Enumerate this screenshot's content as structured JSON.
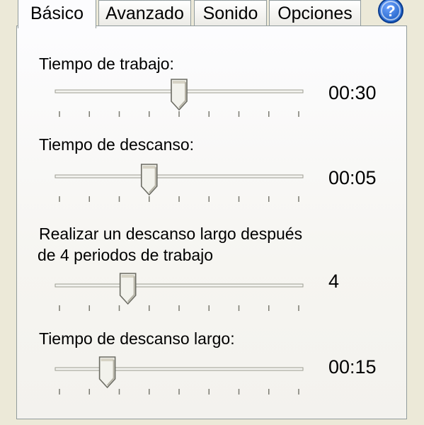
{
  "tabs": [
    {
      "label": "Básico",
      "active": true
    },
    {
      "label": "Avanzado",
      "active": false
    },
    {
      "label": "Sonido",
      "active": false
    },
    {
      "label": "Opciones",
      "active": false
    }
  ],
  "help": {
    "icon": "help-icon",
    "glyph": "?"
  },
  "settings": [
    {
      "label": "Tiempo de trabajo:",
      "value": "00:30",
      "level": 0.5
    },
    {
      "label": "Tiempo de descanso:",
      "value": "00:05",
      "level": 0.375
    },
    {
      "label_line1": "Realizar un descanso largo después",
      "label_line2": "de 4 periodos de trabajo",
      "value": "4",
      "level": 0.286
    },
    {
      "label": "Tiempo de descanso largo:",
      "value": "00:15",
      "level": 0.2
    }
  ],
  "ticks_count": 9,
  "colors": {
    "tab_accent": "#ffc83c",
    "help_blue": "#1c5fc4"
  }
}
